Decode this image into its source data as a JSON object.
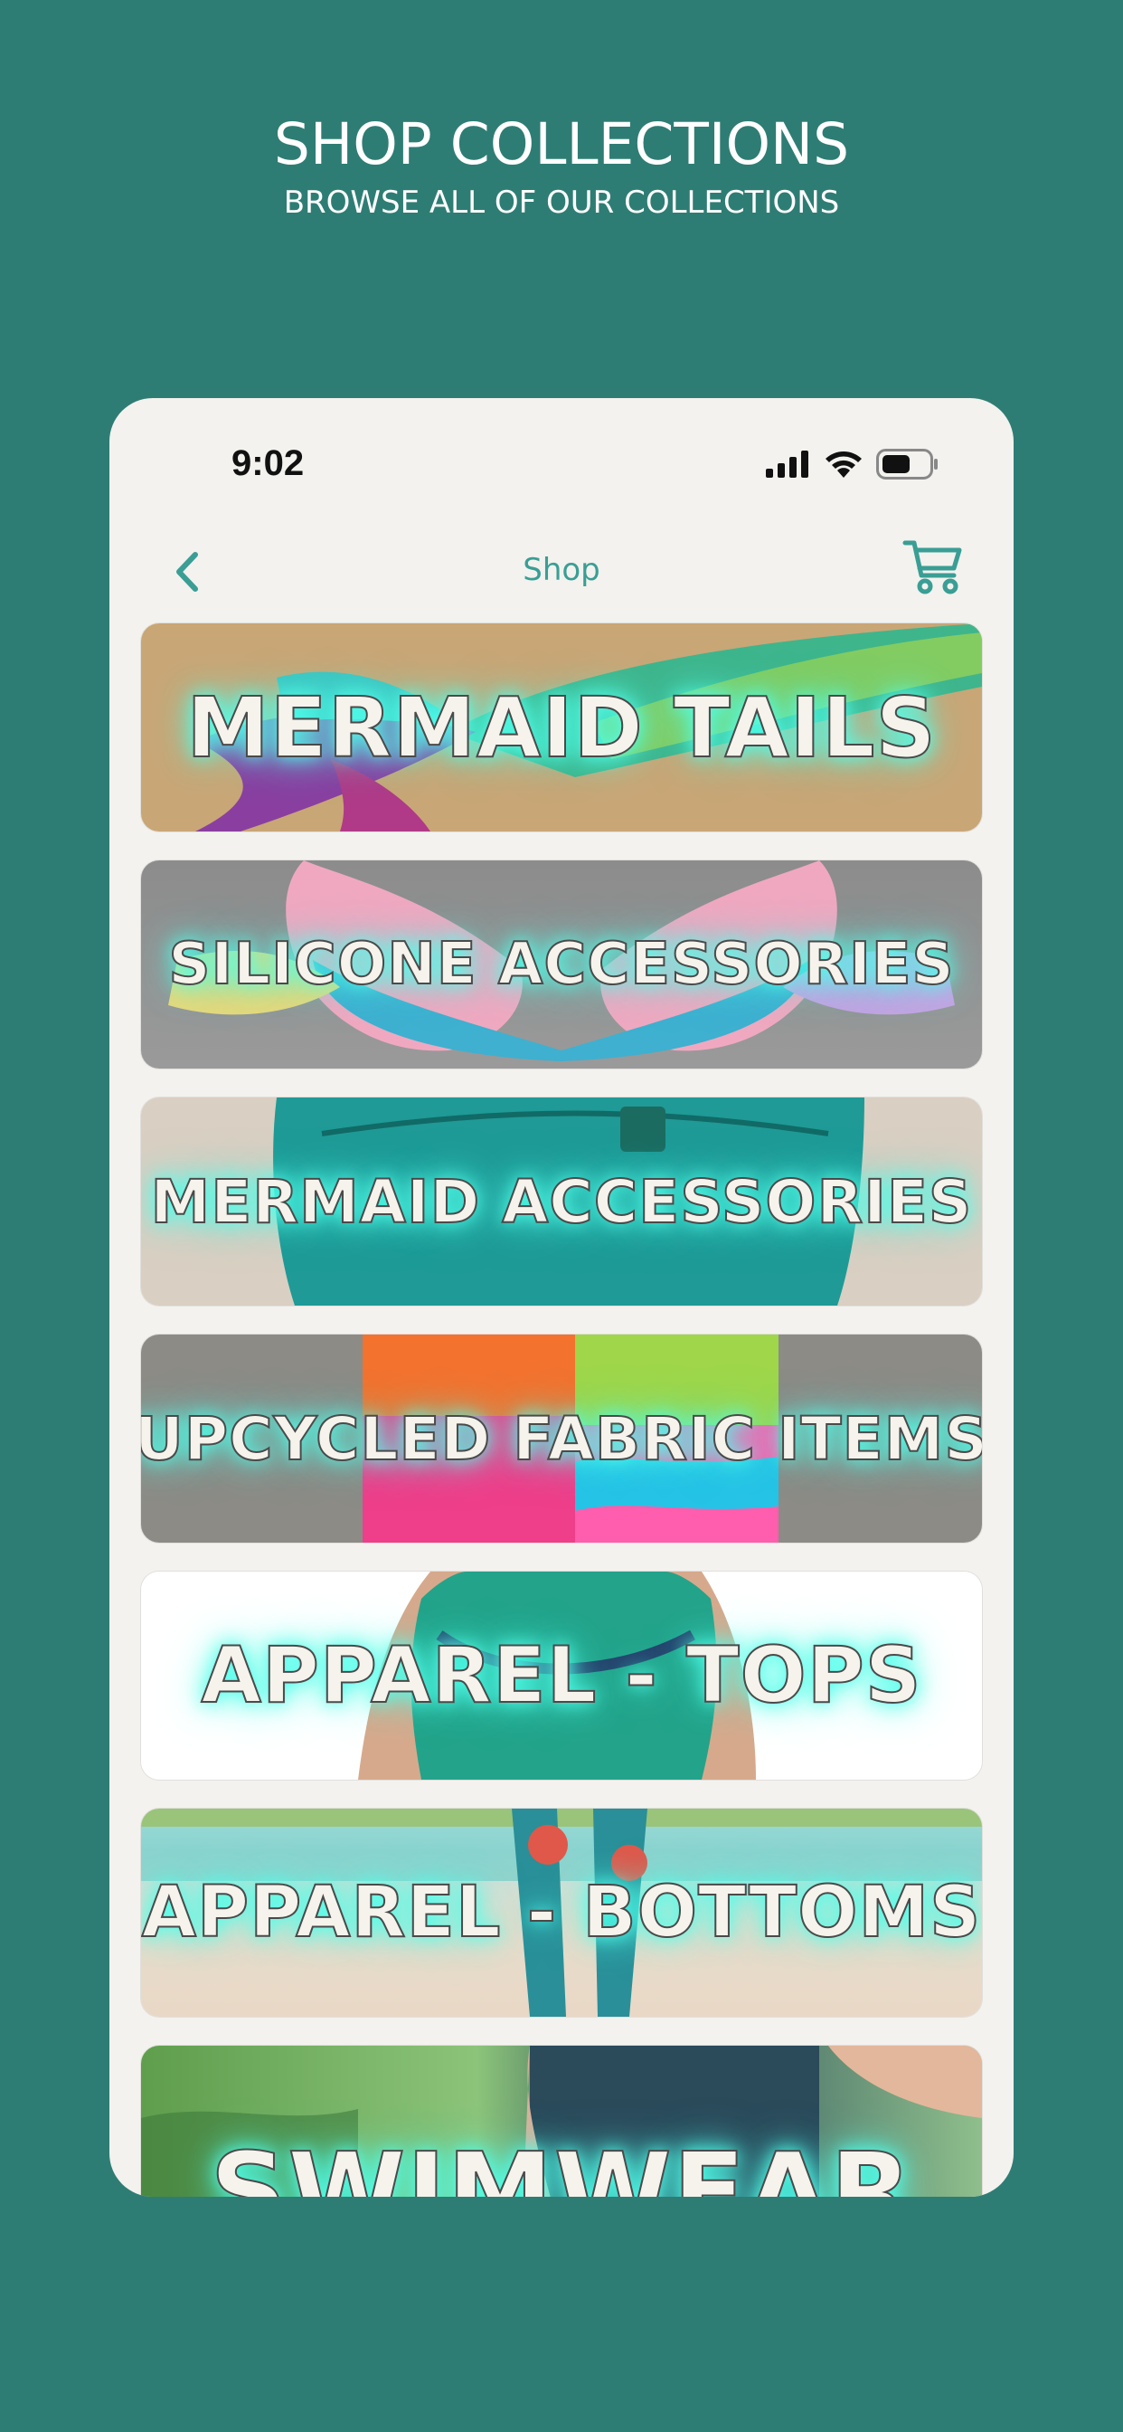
{
  "promo": {
    "title": "SHOP COLLECTIONS",
    "subtitle": "BROWSE ALL OF OUR COLLECTIONS"
  },
  "status_bar": {
    "time": "9:02",
    "icons": [
      "signal-icon",
      "wifi-icon",
      "battery-icon"
    ]
  },
  "nav": {
    "title": "Shop",
    "back_icon": "chevron-left-icon",
    "cart_icon": "cart-icon"
  },
  "collections": [
    {
      "label": "MERMAID TAILS"
    },
    {
      "label": "SILICONE ACCESSORIES"
    },
    {
      "label": "MERMAID ACCESSORIES"
    },
    {
      "label": "UPCYCLED FABRIC ITEMS"
    },
    {
      "label": "APPAREL - TOPS"
    },
    {
      "label": "APPAREL - BOTTOMS"
    },
    {
      "label": "SWIMWEAR"
    }
  ],
  "colors": {
    "background": "#2e7d74",
    "phone_bg": "#f3f2ee",
    "accent": "#3a9e95",
    "label_glow": "#50ffeb"
  }
}
